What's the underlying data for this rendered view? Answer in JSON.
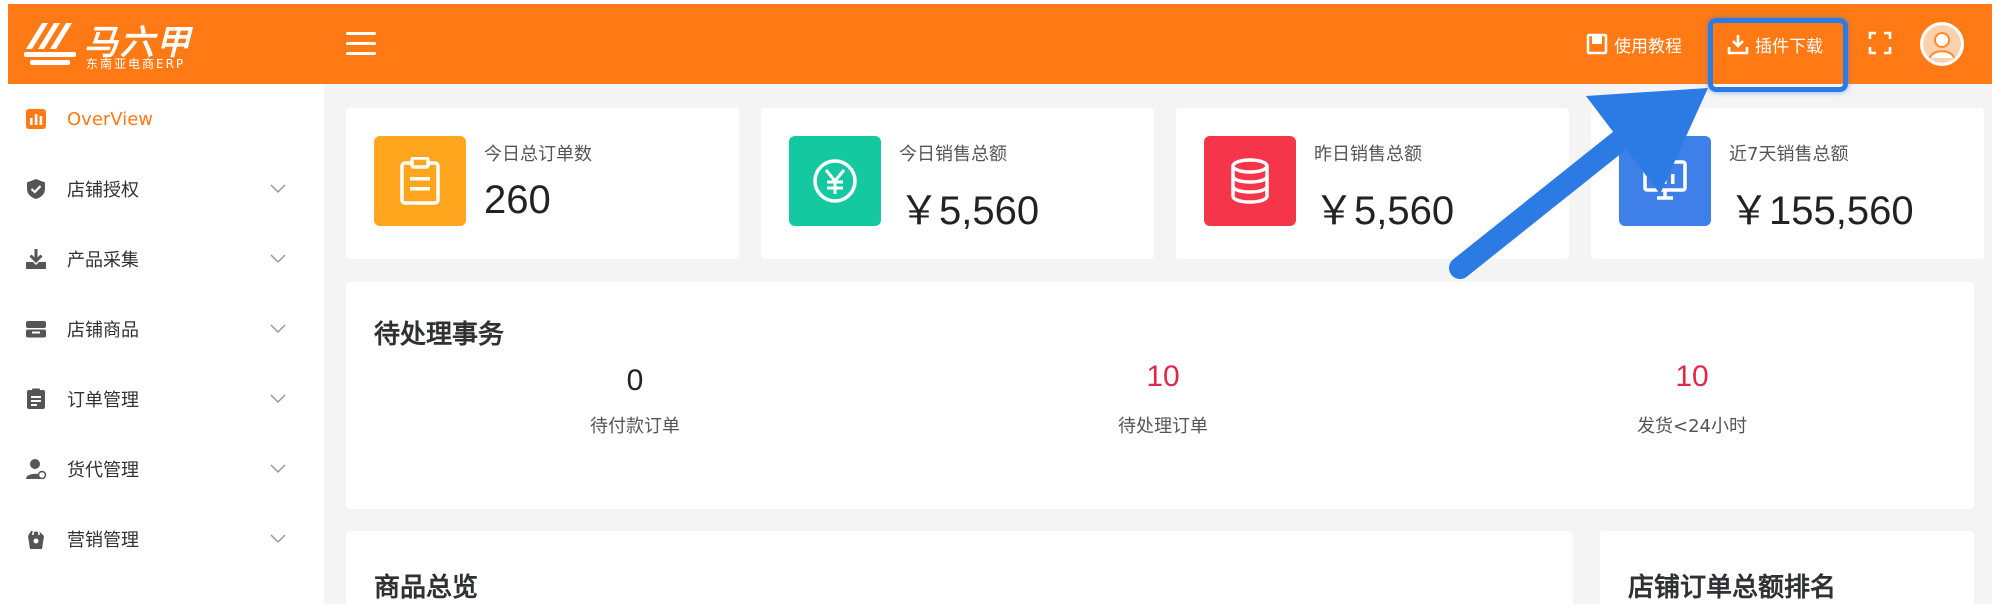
{
  "header": {
    "logo_title": "马六甲",
    "logo_subtitle": "东南亚电商ERP",
    "tutorial_label": "使用教程",
    "download_label": "插件下载",
    "accent_color": "#ff7a14",
    "highlight_color": "#2c7be5"
  },
  "sidebar": {
    "items": [
      {
        "label": "OverView",
        "icon": "bar-chart-icon",
        "active": true
      },
      {
        "label": "店铺授权",
        "icon": "shield-check-icon"
      },
      {
        "label": "产品采集",
        "icon": "download-icon"
      },
      {
        "label": "店铺商品",
        "icon": "store-icon"
      },
      {
        "label": "订单管理",
        "icon": "clipboard-icon"
      },
      {
        "label": "货代管理",
        "icon": "user-icon"
      },
      {
        "label": "营销管理",
        "icon": "shopping-bag-icon"
      }
    ]
  },
  "stats": [
    {
      "label": "今日总订单数",
      "value": "260",
      "icon": "clipboard-icon",
      "color": "#ffa51e"
    },
    {
      "label": "今日销售总额",
      "value": "￥5,560",
      "icon": "yen-circle-icon",
      "color": "#14c9a0"
    },
    {
      "label": "昨日销售总额",
      "value": "￥5,560",
      "icon": "database-icon",
      "color": "#f5364a"
    },
    {
      "label": "近7天销售总额",
      "value": "￥155,560",
      "icon": "monitor-chart-icon",
      "color": "#3f7fe8"
    }
  ],
  "pending": {
    "title": "待处理事务",
    "items": [
      {
        "value": "0",
        "label": "待付款订单"
      },
      {
        "value": "10",
        "label": "待处理订单"
      },
      {
        "value": "10",
        "label": "发货<24小时"
      }
    ]
  },
  "overview_title": "商品总览",
  "ranking_title": "店铺订单总额排名"
}
